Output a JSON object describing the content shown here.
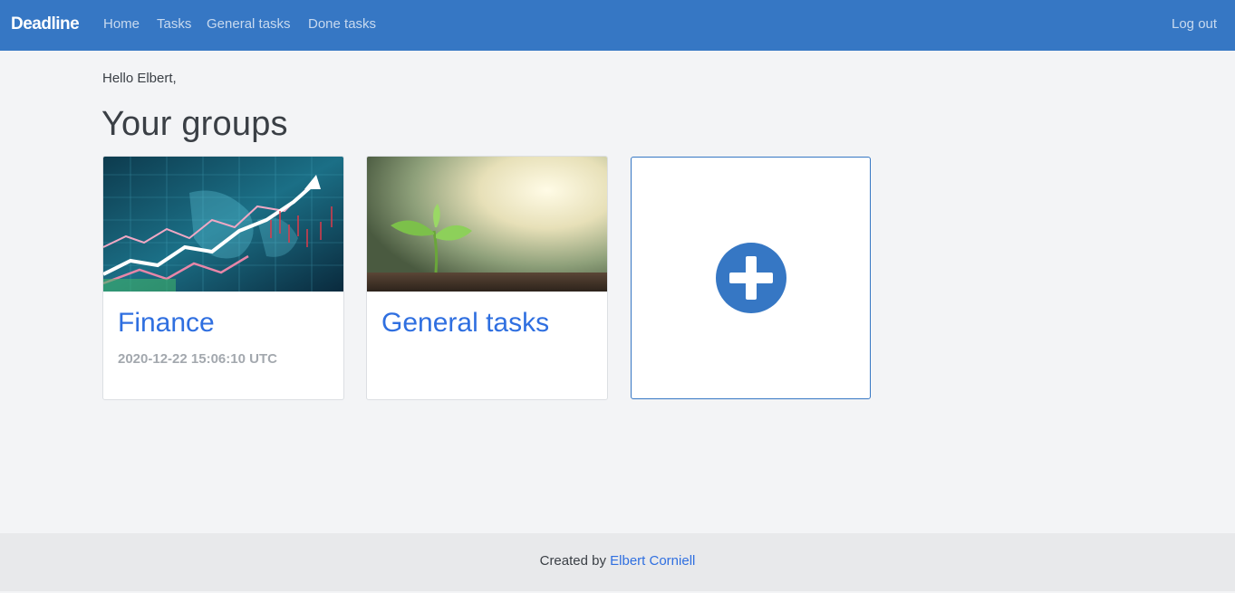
{
  "navbar": {
    "brand": "Deadline",
    "links": [
      "Home",
      "Tasks",
      "General tasks",
      "Done tasks"
    ],
    "logout": "Log out",
    "bg_color": "#3677c4"
  },
  "main": {
    "greeting": "Hello Elbert,",
    "title": "Your groups",
    "groups": [
      {
        "title": "Finance",
        "date": "2020-12-22 15:06:10 UTC",
        "image": "stock-market-chart-image"
      },
      {
        "title": "General tasks",
        "date": "",
        "image": "seedling-sunlight-image"
      }
    ],
    "add_icon": "plus-circle-icon"
  },
  "footer": {
    "prefix": "Created by ",
    "author": "Elbert Corniell"
  },
  "colors": {
    "accent": "#2f6fe0",
    "muted": "#a3a8ae",
    "background": "#f3f4f6"
  }
}
